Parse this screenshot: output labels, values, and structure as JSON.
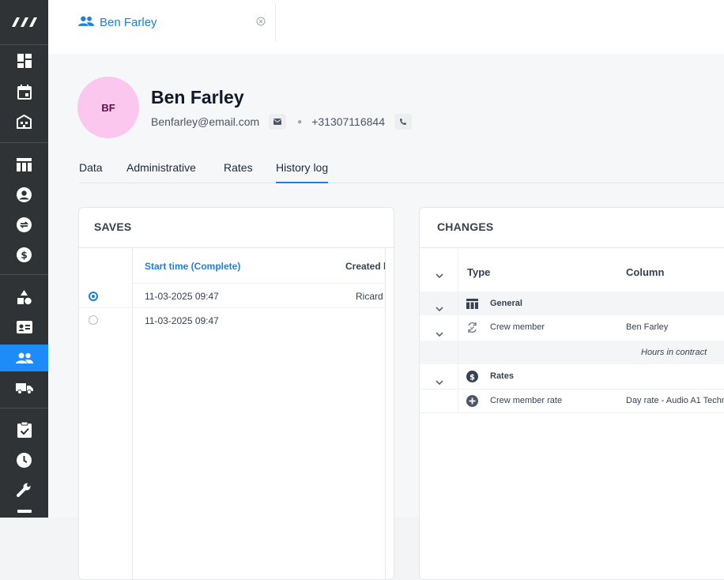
{
  "tab": {
    "label": "Ben Farley"
  },
  "person": {
    "initials": "BF",
    "name": "Ben Farley",
    "email": "Benfarley@email.com",
    "phone": "+31307116844"
  },
  "subtabs": [
    {
      "label": "Data"
    },
    {
      "label": "Administrative"
    },
    {
      "label": "Rates"
    },
    {
      "label": "History log"
    }
  ],
  "saves": {
    "title": "SAVES",
    "columns": [
      "Start time (Complete)",
      "Created b"
    ],
    "rows": [
      {
        "start": "11-03-2025 09:47",
        "created": "Ricard",
        "selected": true
      },
      {
        "start": "11-03-2025 09:47",
        "created": "",
        "selected": false
      }
    ]
  },
  "changes": {
    "title": "CHANGES",
    "columns": [
      "Type",
      "Column"
    ],
    "rows": [
      {
        "kind": "group",
        "type": "General",
        "column": "",
        "icon": "table-icon"
      },
      {
        "kind": "item",
        "type": "Crew member",
        "column": "Ben Farley",
        "icon": "sync-icon"
      },
      {
        "kind": "sub",
        "type": "",
        "column": "Hours in contract",
        "icon": ""
      },
      {
        "kind": "group",
        "type": "Rates",
        "column": "",
        "icon": "dollar-icon"
      },
      {
        "kind": "item",
        "type": "Crew member rate",
        "column": "Day rate - Audio A1 Techni",
        "icon": "plus-circle-icon"
      }
    ]
  },
  "colors": {
    "accent": "#1d7fe0",
    "sidebar": "#2f3336",
    "avatar": "#fbc7ef"
  }
}
